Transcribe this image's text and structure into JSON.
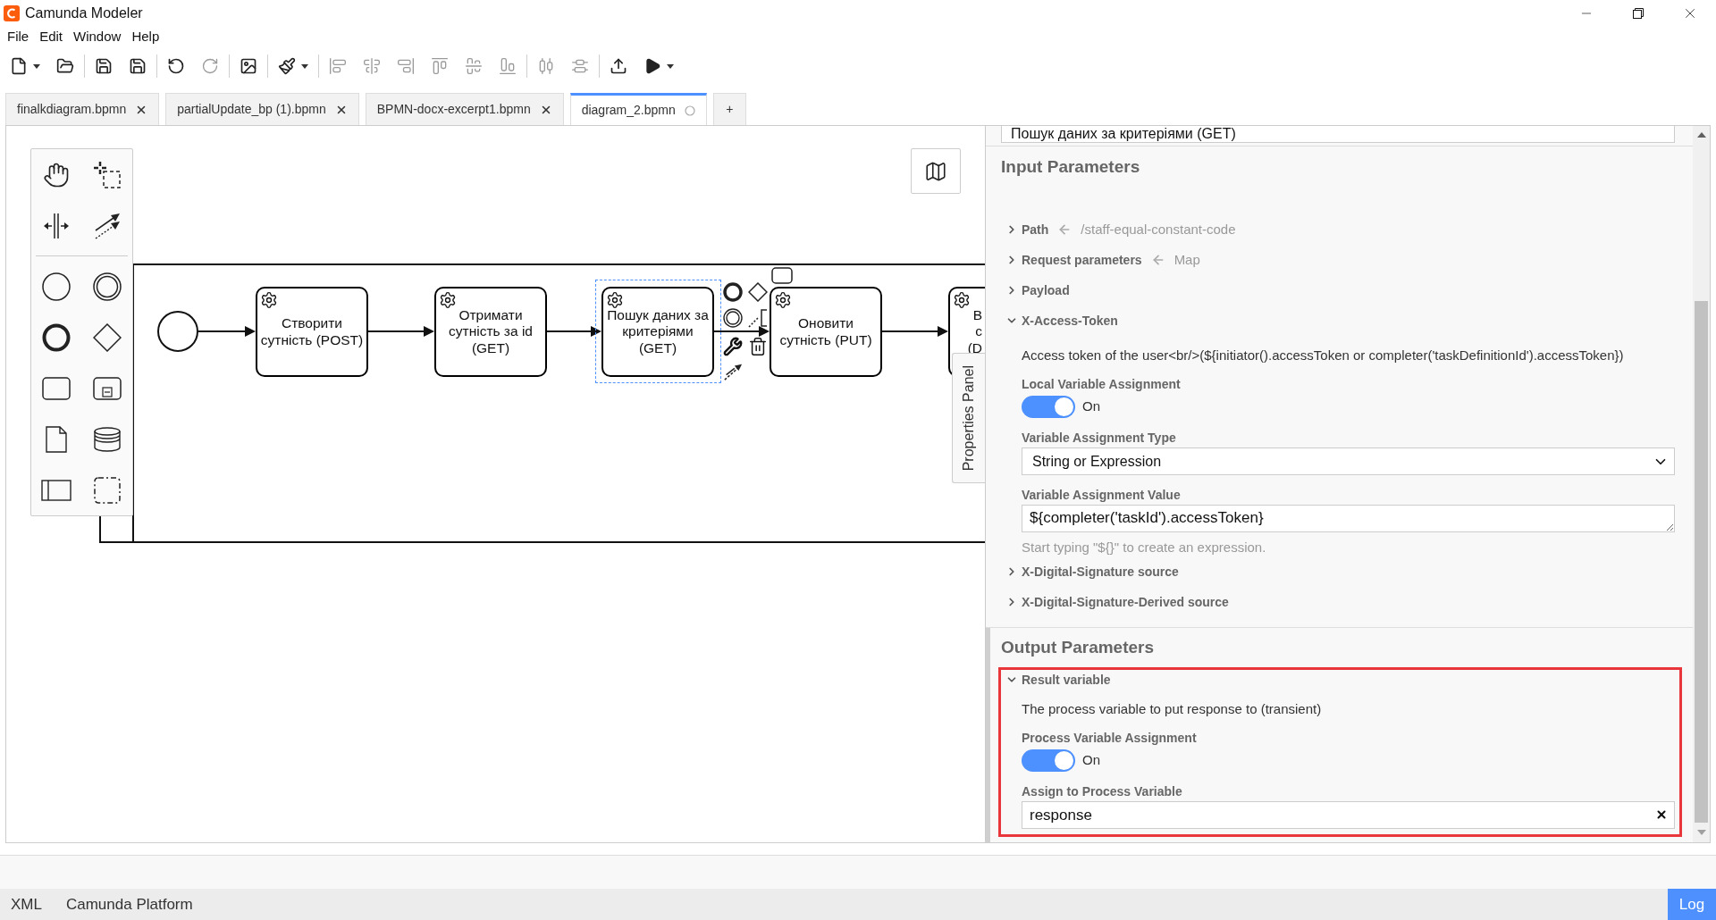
{
  "window": {
    "title": "Camunda Modeler"
  },
  "menu": [
    "File",
    "Edit",
    "Window",
    "Help"
  ],
  "toolbar": [
    [
      {
        "kind": "new",
        "menu": true,
        "disabled": false
      },
      {
        "kind": "open",
        "menu": false,
        "disabled": false
      }
    ],
    [
      {
        "kind": "save",
        "menu": false,
        "disabled": false
      },
      {
        "kind": "save_as",
        "menu": false,
        "disabled": false
      }
    ],
    [
      {
        "kind": "undo",
        "menu": false,
        "disabled": false
      },
      {
        "kind": "redo",
        "menu": false,
        "disabled": true
      }
    ],
    [
      {
        "kind": "export_image",
        "menu": false,
        "disabled": false
      }
    ],
    [
      {
        "kind": "color",
        "menu": true,
        "disabled": false
      }
    ],
    [
      {
        "kind": "align_left",
        "menu": false,
        "disabled": true
      },
      {
        "kind": "align_center",
        "menu": false,
        "disabled": true
      },
      {
        "kind": "align_right",
        "menu": false,
        "disabled": true
      },
      {
        "kind": "align_top",
        "menu": false,
        "disabled": true
      },
      {
        "kind": "align_middle",
        "menu": false,
        "disabled": true
      },
      {
        "kind": "align_bottom",
        "menu": false,
        "disabled": true
      }
    ],
    [
      {
        "kind": "distribute_horizontal",
        "menu": false,
        "disabled": true
      },
      {
        "kind": "distribute_vertical",
        "menu": false,
        "disabled": true
      }
    ],
    [
      {
        "kind": "deploy",
        "menu": false,
        "disabled": false
      },
      {
        "kind": "run",
        "menu": true,
        "disabled": false
      }
    ]
  ],
  "tabs": [
    {
      "label": "finalkdiagram.bpmn",
      "selected": false,
      "unsaved": false
    },
    {
      "label": "partialUpdate_bp (1).bpmn",
      "selected": false,
      "unsaved": false
    },
    {
      "label": "BPMN-docx-excerpt1.bpmn",
      "selected": false,
      "unsaved": false
    },
    {
      "label": "diagram_2.bpmn",
      "selected": true,
      "unsaved": true
    }
  ],
  "new_tab": "+",
  "diagram": {
    "tasks": [
      {
        "label": "Створити сутність (POST)",
        "selected": false
      },
      {
        "label": "Отримати сутність за id (GET)",
        "selected": false
      },
      {
        "label": "Пошук даних за критеріями (GET)",
        "selected": true
      },
      {
        "label": "Оновити сутність (PUT)",
        "selected": false
      },
      {
        "label": "В с (D",
        "selected": false
      }
    ],
    "panel_toggle": "Properties Panel"
  },
  "properties": {
    "name": "Пошук даних за критеріями (GET)",
    "groups": [
      {
        "title": "Input Parameters",
        "entries": [
          {
            "label": "Path",
            "expanded": false,
            "highlighted": false,
            "mapping": "/staff-equal-constant-code"
          },
          {
            "label": "Request parameters",
            "expanded": false,
            "highlighted": false,
            "mapping": "Map"
          },
          {
            "label": "Payload",
            "expanded": false,
            "highlighted": false
          },
          {
            "label": "X-Access-Token",
            "expanded": true,
            "highlighted": false,
            "description": "Access token of the user<br/>(${initiator().accessToken or completer('taskDefinitionId').accessToken})",
            "toggle": {
              "label": "Local Variable Assignment",
              "on": true,
              "text": "On"
            },
            "fields": [
              {
                "kind": "select",
                "label": "Variable Assignment Type",
                "value": "String or Expression"
              },
              {
                "kind": "textarea",
                "label": "Variable Assignment Value",
                "value": "${completer('taskId').accessToken}",
                "hint": "Start typing \"${}\" to create an expression."
              }
            ]
          },
          {
            "label": "X-Digital-Signature source",
            "expanded": false,
            "highlighted": false
          },
          {
            "label": "X-Digital-Signature-Derived source",
            "expanded": false,
            "highlighted": false
          }
        ]
      },
      {
        "title": "Output Parameters",
        "entries": [
          {
            "label": "Result variable",
            "expanded": true,
            "highlighted": true,
            "description": "The process variable to put response to (transient)",
            "toggle": {
              "label": "Process Variable Assignment",
              "on": true,
              "text": "On"
            },
            "fields": [
              {
                "kind": "input",
                "label": "Assign to Process Variable",
                "value": "response"
              }
            ]
          }
        ]
      }
    ]
  },
  "status_bar": {
    "items": [
      "XML",
      "Camunda Platform"
    ],
    "log": "Log"
  }
}
